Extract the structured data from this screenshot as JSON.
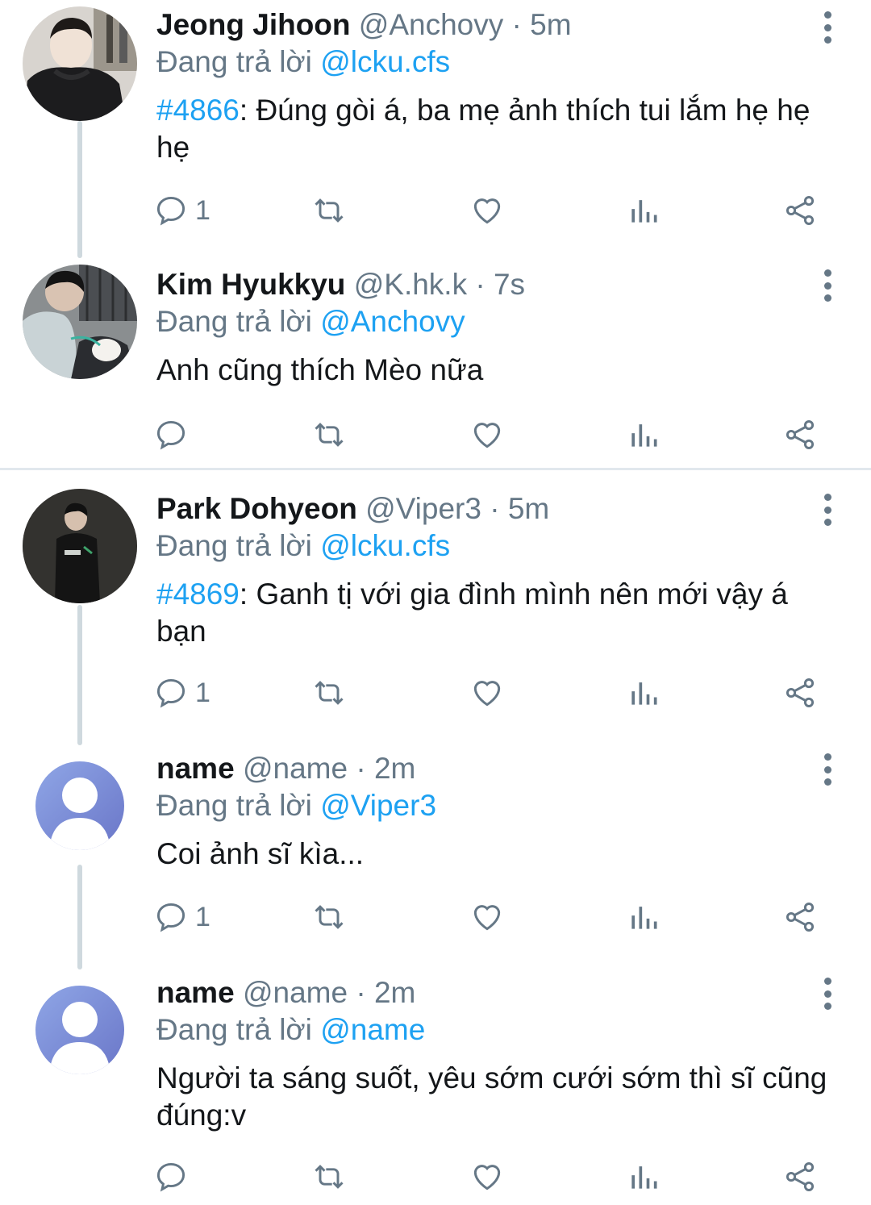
{
  "tweets": [
    {
      "name": "Jeong Jihoon",
      "handle": "@Anchovy",
      "time": "5m",
      "reply_prefix": "Đang trả lời",
      "reply_to": "@lcku.cfs",
      "hashtag": "#4866",
      "text": ": Đúng gòi á, ba mẹ ảnh thích tui lắm hẹ hẹ hẹ",
      "reply_count": "1"
    },
    {
      "name": "Kim Hyukkyu",
      "handle": "@K.hk.k",
      "time": "7s",
      "reply_prefix": "Đang trả lời",
      "reply_to": "@Anchovy",
      "text": "Anh cũng thích Mèo nữa",
      "reply_count": ""
    },
    {
      "name": "Park Dohyeon",
      "handle": "@Viper3",
      "time": "5m",
      "reply_prefix": "Đang trả lời",
      "reply_to": "@lcku.cfs",
      "hashtag": "#4869",
      "text": ": Ganh tị với gia đình mình nên mới vậy á bạn",
      "reply_count": "1"
    },
    {
      "name": "name",
      "handle": "@name",
      "time": "2m",
      "reply_prefix": "Đang trả lời",
      "reply_to": "@Viper3",
      "text": "Coi ảnh sĩ kìa...",
      "reply_count": "1"
    },
    {
      "name": "name",
      "handle": "@name",
      "time": "2m",
      "reply_prefix": "Đang trả lời",
      "reply_to": "@name",
      "text": "Người ta sáng suốt, yêu sớm cưới sớm thì sĩ cũng đúng:v",
      "reply_count": ""
    }
  ],
  "separator": "·",
  "icons": {
    "reply": "reply-icon",
    "retweet": "retweet-icon",
    "like": "heart-icon",
    "views": "views-icon",
    "share": "share-icon",
    "more": "more-vertical-icon"
  },
  "colors": {
    "link": "#1da1f2",
    "secondary": "#657786",
    "thread_line": "#cfd9de",
    "default_avatar": "#7b8fd6"
  }
}
